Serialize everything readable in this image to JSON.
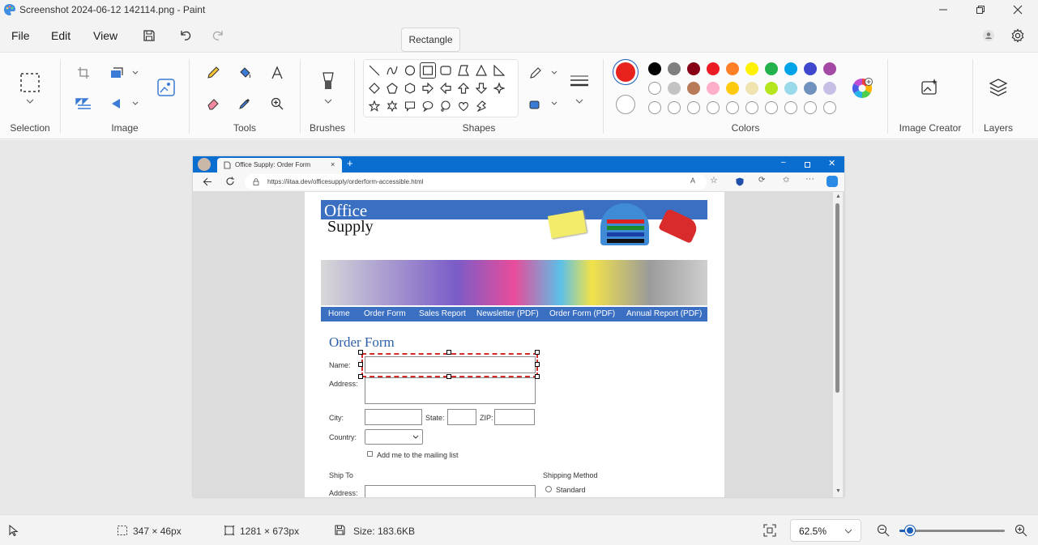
{
  "window": {
    "title": "Screenshot 2024-06-12 142114.png - Paint"
  },
  "menu": {
    "file": "File",
    "edit": "Edit",
    "view": "View"
  },
  "ribbon": {
    "groups": {
      "selection": "Selection",
      "image": "Image",
      "tools": "Tools",
      "brushes": "Brushes",
      "shapes": "Shapes",
      "colors": "Colors",
      "image_creator": "Image Creator",
      "layers": "Layers"
    },
    "tooltip": "Rectangle",
    "primary_color": "#e8231d",
    "secondary_color": "#ffffff",
    "palette_row1": [
      "#000000",
      "#7f7f7f",
      "#880015",
      "#ed1c24",
      "#ff7f27",
      "#fff200",
      "#22b14c",
      "#00a2e8",
      "#3f48cc",
      "#a349a4"
    ],
    "palette_row2": [
      "#ffffff",
      "#c3c3c3",
      "#b97a57",
      "#ffaec9",
      "#ffc90e",
      "#efe4b0",
      "#b5e61d",
      "#99d9ea",
      "#7092be",
      "#c8bfe7"
    ]
  },
  "browser": {
    "tab_title": "Office Supply: Order Form",
    "url": "https://iitaa.dev/officesupply/orderform-accessible.html"
  },
  "site": {
    "brand_line1": "Office",
    "brand_line2": "Supply",
    "nav": [
      "Home",
      "Order Form",
      "Sales Report",
      "Newsletter (PDF)",
      "Order Form (PDF)",
      "Annual Report (PDF)"
    ],
    "form_title": "Order Form",
    "labels": {
      "name": "Name:",
      "address": "Address:",
      "city": "City:",
      "state": "State:",
      "zip": "ZIP:",
      "country": "Country:",
      "mailing": "Add me to the mailing list",
      "ship_to": "Ship To",
      "ship_address": "Address:",
      "shipping_method": "Shipping Method",
      "standard": "Standard"
    }
  },
  "status": {
    "selection_size": "347 × 46px",
    "canvas_size": "1281 × 673px",
    "file_size": "Size: 183.6KB",
    "zoom": "62.5%",
    "zoom_level": 0.1
  }
}
